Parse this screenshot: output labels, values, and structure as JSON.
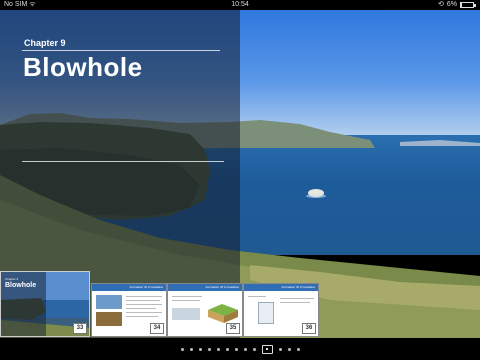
{
  "status_bar": {
    "carrier": "No SIM",
    "time": "10:54",
    "battery_percent": "6%",
    "battery_level": 0.06
  },
  "chapter": {
    "label": "Chapter 9",
    "title": "Blowhole"
  },
  "thumbnails": {
    "current": {
      "label": "Chapter 9",
      "title": "Blowhole",
      "page": "33"
    },
    "pages": [
      {
        "page": "34",
        "header": "Formation Of A Coastline"
      },
      {
        "page": "35",
        "header": "Formation Of A Coastline"
      },
      {
        "page": "36",
        "header": "Formation Of A Coastline"
      }
    ]
  },
  "pagination": {
    "total_dots": 13,
    "active_index": 9
  }
}
